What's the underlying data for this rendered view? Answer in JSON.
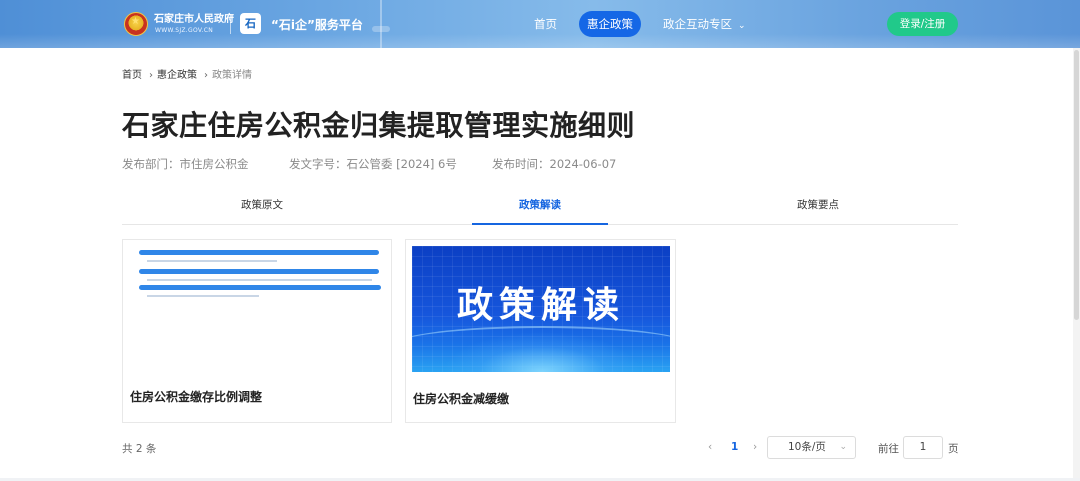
{
  "header": {
    "gov_name": "石家庄市人民政府",
    "gov_url": "WWW.SJZ.GOV.CN",
    "platform_logo": "石",
    "platform_name": "“石i企”服务平台",
    "nav": [
      {
        "label": "首页"
      },
      {
        "label": "惠企政策"
      },
      {
        "label": "政企互动专区"
      }
    ],
    "login_label": "登录/注册",
    "accent_color": "#1567e6",
    "login_color": "#21c98a"
  },
  "breadcrumb": [
    "首页",
    "惠企政策",
    "政策详情"
  ],
  "title": "石家庄住房公积金归集提取管理实施细则",
  "meta": {
    "dept": "发布部门：市住房公积金",
    "doc_no": "发文字号：石公管委 [2024] 6号",
    "date": "发布时间：2024-06-07"
  },
  "tabs": [
    {
      "label": "政策原文"
    },
    {
      "label": "政策解读"
    },
    {
      "label": "政策要点"
    }
  ],
  "cards": [
    {
      "title": "住房公积金缴存比例调整"
    },
    {
      "title": "住房公积金减缓缴",
      "banner_text": "政策解读"
    }
  ],
  "pagination": {
    "total": "共 2 条",
    "prev": "‹",
    "current": "1",
    "next": "›",
    "page_size": "10条/页",
    "goto_label": "前往",
    "goto_value": "1",
    "page_label": "页"
  }
}
